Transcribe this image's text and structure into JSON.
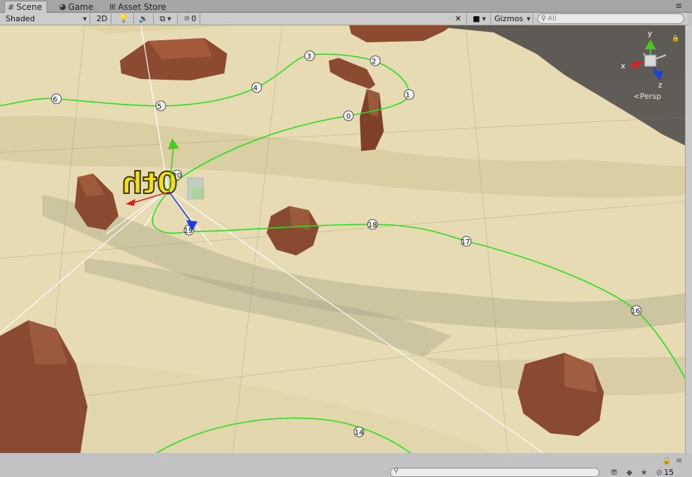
{
  "tabs": [
    {
      "label": "Scene",
      "icon": "grid-icon"
    },
    {
      "label": "Game",
      "icon": "pacman-icon"
    },
    {
      "label": "Asset Store",
      "icon": "bag-icon"
    }
  ],
  "toolbar": {
    "draw_mode": "Shaded",
    "mode_2d": "2D",
    "hidden_count": "0",
    "gizmos": "Gizmos",
    "search_placeholder": "All"
  },
  "gizmo": {
    "axis_y": "y",
    "axis_x": "x",
    "axis_z": "z",
    "projection": "Persp"
  },
  "scene": {
    "waypoints": [
      "0",
      "1",
      "2",
      "3",
      "4",
      "5",
      "6",
      "14",
      "16",
      "17",
      "18",
      "19",
      "20"
    ],
    "object_label": "0th"
  },
  "statusbar": {
    "visible_count": "15"
  },
  "colors": {
    "path": "#22e01e",
    "terrain": "#e7dcb4",
    "rock": "#8a4a30",
    "axis_x": "#e02020",
    "axis_y": "#4cc820",
    "axis_z": "#1c3ee0"
  }
}
